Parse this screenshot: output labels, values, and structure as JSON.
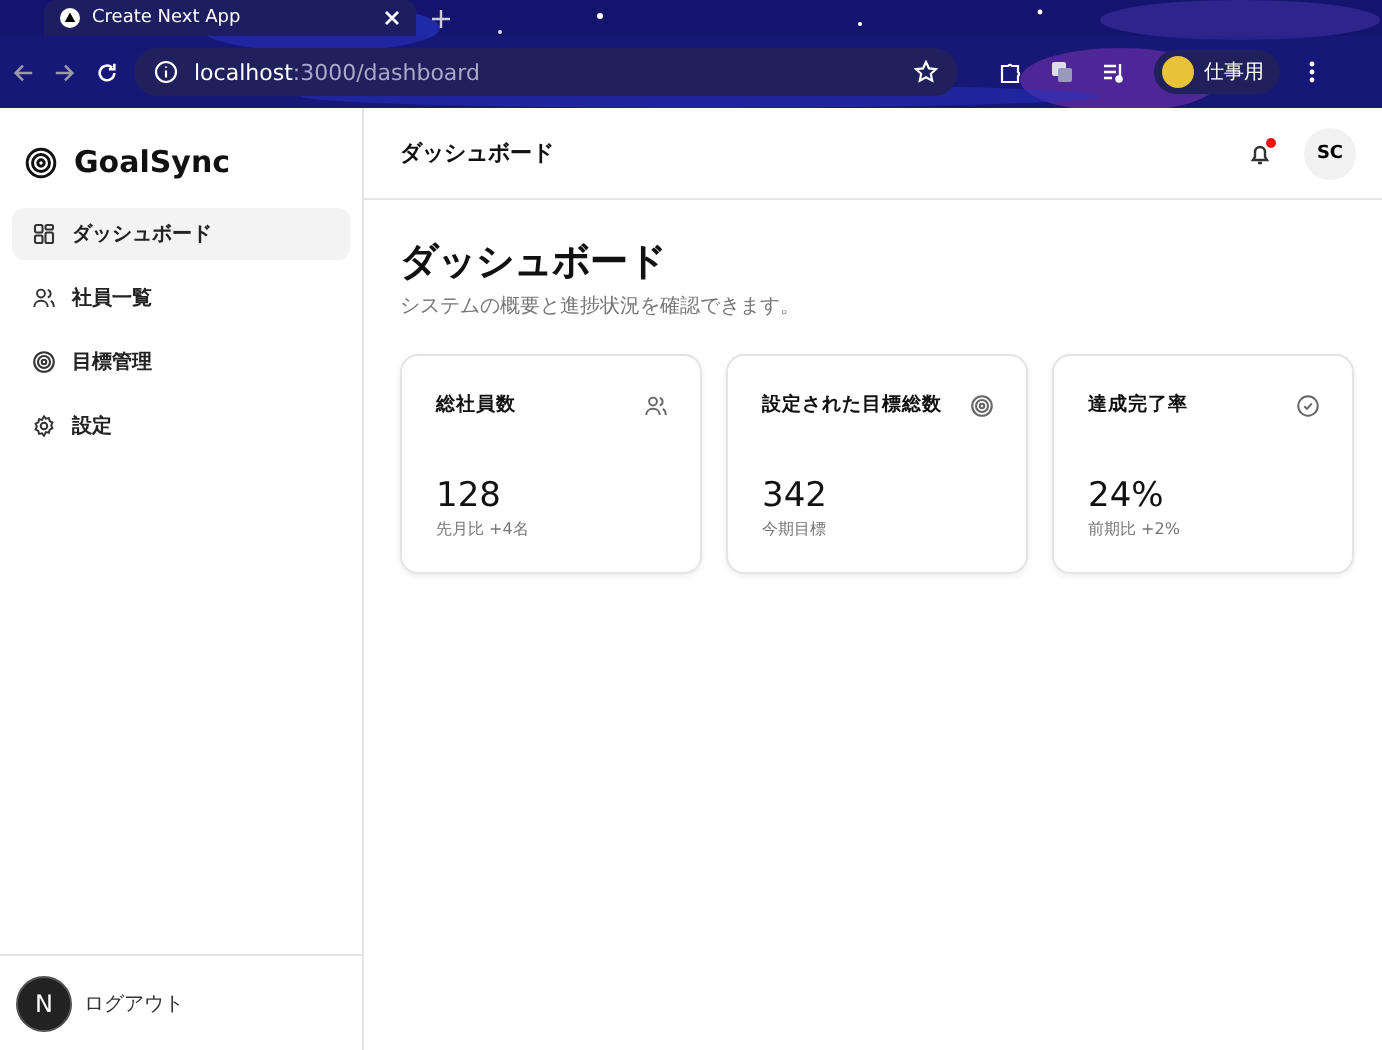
{
  "browser": {
    "tab_title": "Create Next App",
    "url_host": "localhost",
    "url_path": ":3000/dashboard",
    "profile_label": "仕事用"
  },
  "sidebar": {
    "brand": "GoalSync",
    "items": [
      {
        "label": "ダッシュボード",
        "kind": "grid",
        "selected": true
      },
      {
        "label": "社員一覧",
        "kind": "users",
        "selected": false
      },
      {
        "label": "目標管理",
        "kind": "target",
        "selected": false
      },
      {
        "label": "設定",
        "kind": "gear",
        "selected": false
      }
    ],
    "logout": "ログアウト",
    "dev_badge": "N"
  },
  "header": {
    "title": "ダッシュボード",
    "notification_dot": true,
    "avatar": "SC"
  },
  "page": {
    "title": "ダッシュボード",
    "subtitle": "システムの概要と進捗状況を確認できます。"
  },
  "cards": [
    {
      "title": "総社員数",
      "kind": "users",
      "value": "128",
      "note": "先月比 +4名"
    },
    {
      "title": "設定された目標総数",
      "kind": "target",
      "value": "342",
      "note": "今期目標"
    },
    {
      "title": "達成完了率",
      "kind": "check",
      "value": "24%",
      "note": "前期比 +2%"
    }
  ]
}
